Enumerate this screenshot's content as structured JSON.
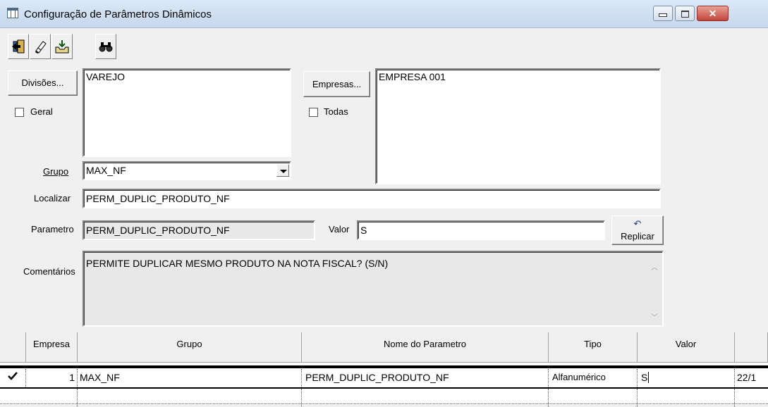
{
  "window": {
    "title": "Configuração de Parâmetros Dinâmicos",
    "controls": [
      "minimize",
      "maximize",
      "close"
    ]
  },
  "toolbar": {
    "buttons": [
      {
        "name": "exit",
        "icon": "door-exit-icon"
      },
      {
        "name": "erase",
        "icon": "eraser-icon"
      },
      {
        "name": "save",
        "icon": "inbox-save-icon"
      },
      {
        "name": "find",
        "icon": "binoculars-icon"
      }
    ]
  },
  "divisoes": {
    "button_label": "Divisões...",
    "checkbox_label": "Geral",
    "checked": false,
    "list": [
      "VAREJO"
    ]
  },
  "empresas": {
    "button_label": "Empresas...",
    "checkbox_label": "Todas",
    "checked": false,
    "list": [
      "EMPRESA 001"
    ]
  },
  "grupo": {
    "label": "Grupo",
    "value": "MAX_NF"
  },
  "localizar": {
    "label": "Localizar",
    "value": "PERM_DUPLIC_PRODUTO_NF"
  },
  "parametro": {
    "label": "Parametro",
    "value": "PERM_DUPLIC_PRODUTO_NF"
  },
  "valor": {
    "label": "Valor",
    "value": "S"
  },
  "replicar": {
    "label": "Replicar",
    "icon": "undo-arrow-icon"
  },
  "comentarios": {
    "label": "Comentários",
    "value": "PERMITE DUPLICAR MESMO PRODUTO NA NOTA FISCAL? (S/N)"
  },
  "grid": {
    "columns": [
      "Empresa",
      "Grupo",
      "Nome do Parametro",
      "Tipo",
      "Valor",
      ""
    ],
    "rows": [
      {
        "selected": true,
        "empresa": "1",
        "grupo": "MAX_NF",
        "nome": "PERM_DUPLIC_PRODUTO_NF",
        "tipo": "Alfanumérico",
        "valor": "S",
        "extra": "22/1"
      }
    ]
  }
}
